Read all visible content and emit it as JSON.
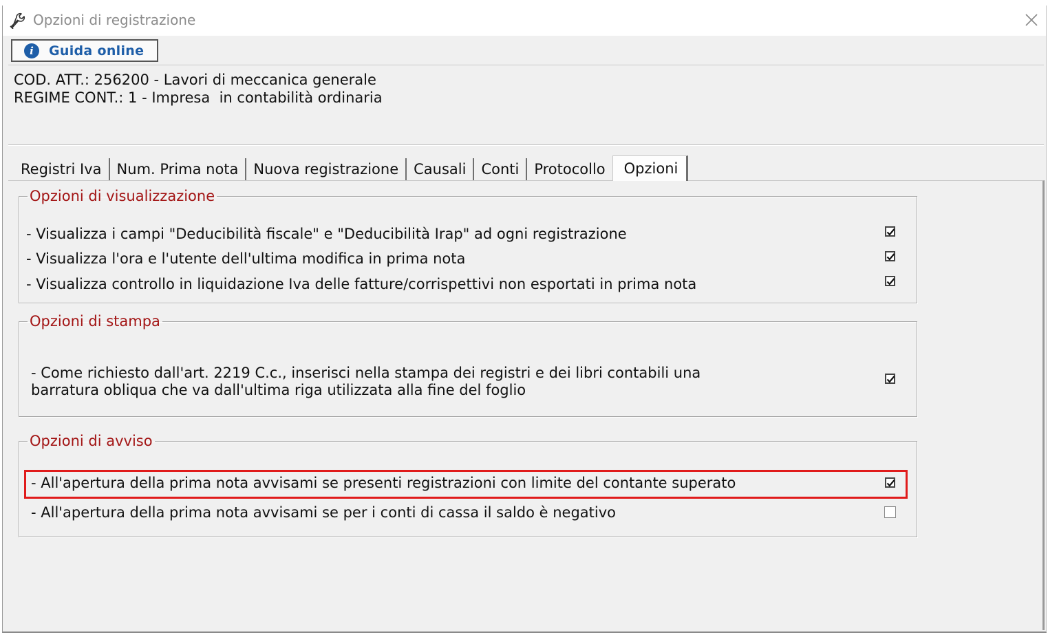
{
  "window": {
    "title": "Opzioni di registrazione"
  },
  "guide_button": {
    "label": "Guida online"
  },
  "info": {
    "line1": "COD. ATT.: 256200 - Lavori di meccanica generale",
    "line2": "REGIME CONT.: 1 - Impresa  in contabilità ordinaria"
  },
  "tabs": [
    {
      "label": "Registri Iva"
    },
    {
      "label": "Num. Prima nota"
    },
    {
      "label": "Nuova registrazione"
    },
    {
      "label": "Causali"
    },
    {
      "label": "Conti"
    },
    {
      "label": "Protocollo"
    },
    {
      "label": "Opzioni",
      "active": true
    }
  ],
  "groups": {
    "visualizzazione": {
      "title": "Opzioni di visualizzazione",
      "items": [
        {
          "label": "- Visualizza i campi \"Deducibilità fiscale\" e \"Deducibilità Irap\" ad ogni registrazione",
          "checked": true
        },
        {
          "label": "- Visualizza l'ora e l'utente dell'ultima modifica in prima nota",
          "checked": true
        },
        {
          "label": "- Visualizza controllo in liquidazione Iva delle fatture/corrispettivi non esportati in prima nota",
          "checked": true
        }
      ]
    },
    "stampa": {
      "title": "Opzioni di stampa",
      "items": [
        {
          "line1": "- Come richiesto dall'art. 2219 C.c., inserisci nella stampa dei registri e dei libri contabili una",
          "line2": "barratura obliqua che va dall'ultima riga utilizzata alla fine del foglio",
          "checked": true
        }
      ]
    },
    "avviso": {
      "title": "Opzioni di avviso",
      "items": [
        {
          "label": "- All'apertura della prima nota avvisami se presenti registrazioni con limite del contante superato",
          "checked": true,
          "highlighted": true
        },
        {
          "label": "- All'apertura della prima nota avvisami se per i conti di cassa il saldo è negativo",
          "checked": false
        }
      ]
    }
  },
  "colors": {
    "group_title": "#a31616",
    "highlight": "#e01b1b",
    "link": "#1e5ea8"
  }
}
